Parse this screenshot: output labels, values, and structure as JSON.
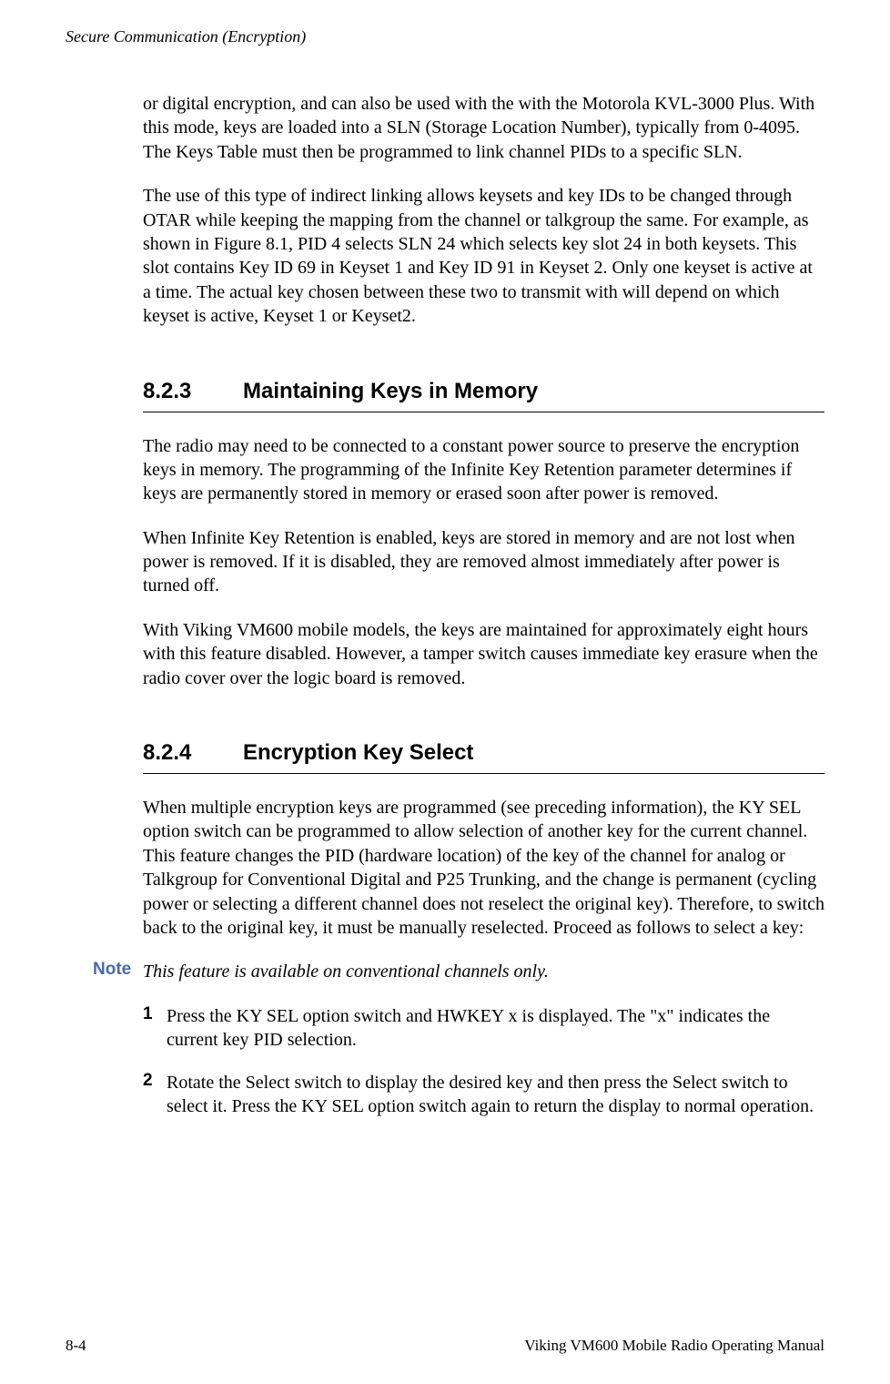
{
  "header": "Secure Communication (Encryption)",
  "intro": {
    "p1": "or digital encryption, and can also be used with the with the Motorola KVL-3000 Plus. With this mode, keys are loaded into a SLN (Storage Location Number), typically from 0-4095. The Keys Table must then be programmed to link channel PIDs to a specific SLN.",
    "p2": "The use of this type of indirect linking allows keysets and key IDs to be changed through OTAR while keeping the mapping from the channel or talkgroup the same. For example, as shown in Figure 8.1, PID 4 selects SLN 24 which selects key slot 24 in both keysets. This slot contains Key ID 69 in Keyset 1 and Key ID 91 in Keyset 2. Only one keyset is active at a time. The actual key chosen between these two to transmit with will depend on which keyset is active, Keyset 1 or Keyset2."
  },
  "section1": {
    "num": "8.2.3",
    "title": "Maintaining Keys in Memory",
    "p1": "The radio may need to be connected to a constant power source to preserve the encryption keys in memory. The programming of the Infinite Key Retention parameter determines if keys are permanently stored in memory or erased soon after power is removed.",
    "p2": "When Infinite Key Retention is enabled, keys are stored in memory and are not lost when power is removed. If it is disabled, they are removed almost immediately after power is turned off.",
    "p3": "With Viking VM600 mobile models, the keys are maintained for approximately eight hours with this feature disabled. However, a tamper switch causes immediate key erasure when the radio cover over the logic board is removed."
  },
  "section2": {
    "num": "8.2.4",
    "title": "Encryption Key Select",
    "p1": "When multiple encryption keys are programmed (see preceding information), the KY SEL option switch can be programmed to allow selection of another key for the current channel. This feature changes the PID (hardware location) of the key of the channel for analog or Talkgroup for Conventional Digital and P25 Trunking, and the change is permanent (cycling power or selecting a different channel does not reselect the original key). Therefore, to switch back to the original key, it must be manually reselected. Proceed as follows to select a key:",
    "note_label": "Note",
    "note_text": "This feature is available on conventional channels only.",
    "step1_num": "1",
    "step1": "Press the KY SEL option switch and HWKEY x is displayed. The \"x\" indicates the current key PID selection.",
    "step2_num": "2",
    "step2": "Rotate the Select switch to display the desired key and then press the Select switch to select it. Press the KY SEL option switch again to return the display to normal operation."
  },
  "footer": {
    "left": "8-4",
    "right": "Viking VM600 Mobile Radio Operating Manual"
  }
}
